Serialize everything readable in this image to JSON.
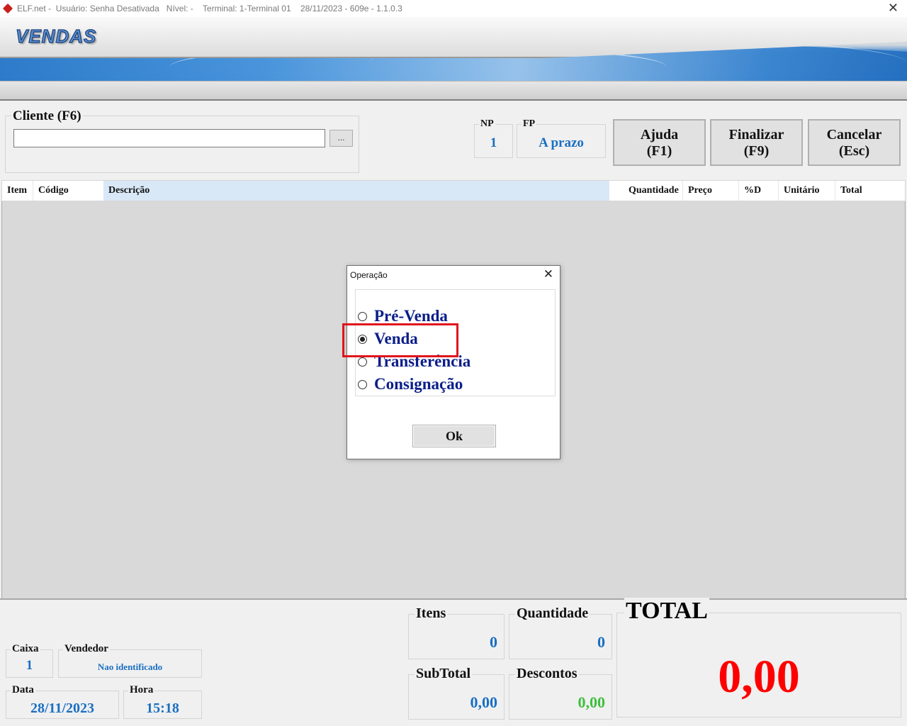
{
  "window": {
    "title": "ELF.net -  Usuário: Senha Desativada   Nível: -    Terminal: 1-Terminal 01    28/11/2023 - 609e - 1.1.0.3",
    "close": "✕"
  },
  "banner": {
    "logo": "VENDAS"
  },
  "cliente": {
    "label": "Cliente (F6)",
    "value": "",
    "browse": "..."
  },
  "np": {
    "label": "NP",
    "value": "1"
  },
  "fp": {
    "label": "FP",
    "value": "A prazo"
  },
  "buttons": {
    "ajuda": {
      "line1": "Ajuda",
      "line2": "(F1)"
    },
    "finalizar": {
      "line1": "Finalizar",
      "line2": "(F9)"
    },
    "cancelar": {
      "line1": "Cancelar",
      "line2": "(Esc)"
    }
  },
  "grid": {
    "columns": [
      "Item",
      "Código",
      "Descrição",
      "Quantidade",
      "Preço",
      "%D",
      "Unitário",
      "Total"
    ],
    "rows": []
  },
  "dialog": {
    "title": "Operação",
    "close": "✕",
    "options": [
      {
        "label": "Pré-Venda",
        "selected": false
      },
      {
        "label": "Venda",
        "selected": true
      },
      {
        "label": "Transferência",
        "selected": false
      },
      {
        "label": "Consignação",
        "selected": false
      }
    ],
    "ok": "Ok"
  },
  "footer": {
    "caixa": {
      "label": "Caixa",
      "value": "1"
    },
    "vendedor": {
      "label": "Vendedor",
      "value": "Nao identificado"
    },
    "data": {
      "label": "Data",
      "value": "28/11/2023"
    },
    "hora": {
      "label": "Hora",
      "value": "15:18"
    },
    "itens": {
      "label": "Itens",
      "value": "0"
    },
    "quantidade": {
      "label": "Quantidade",
      "value": "0"
    },
    "subtotal": {
      "label": "SubTotal",
      "value": "0,00"
    },
    "descontos": {
      "label": "Descontos",
      "value": "0,00"
    },
    "total": {
      "label": "TOTAL",
      "value": "0,00"
    }
  },
  "colors": {
    "value_blue": "#1a6fc2",
    "option_navy": "#0a1e8a",
    "total_red": "#ff0000",
    "discount_green": "#3fbf3f",
    "highlight_red": "#e0141c"
  }
}
